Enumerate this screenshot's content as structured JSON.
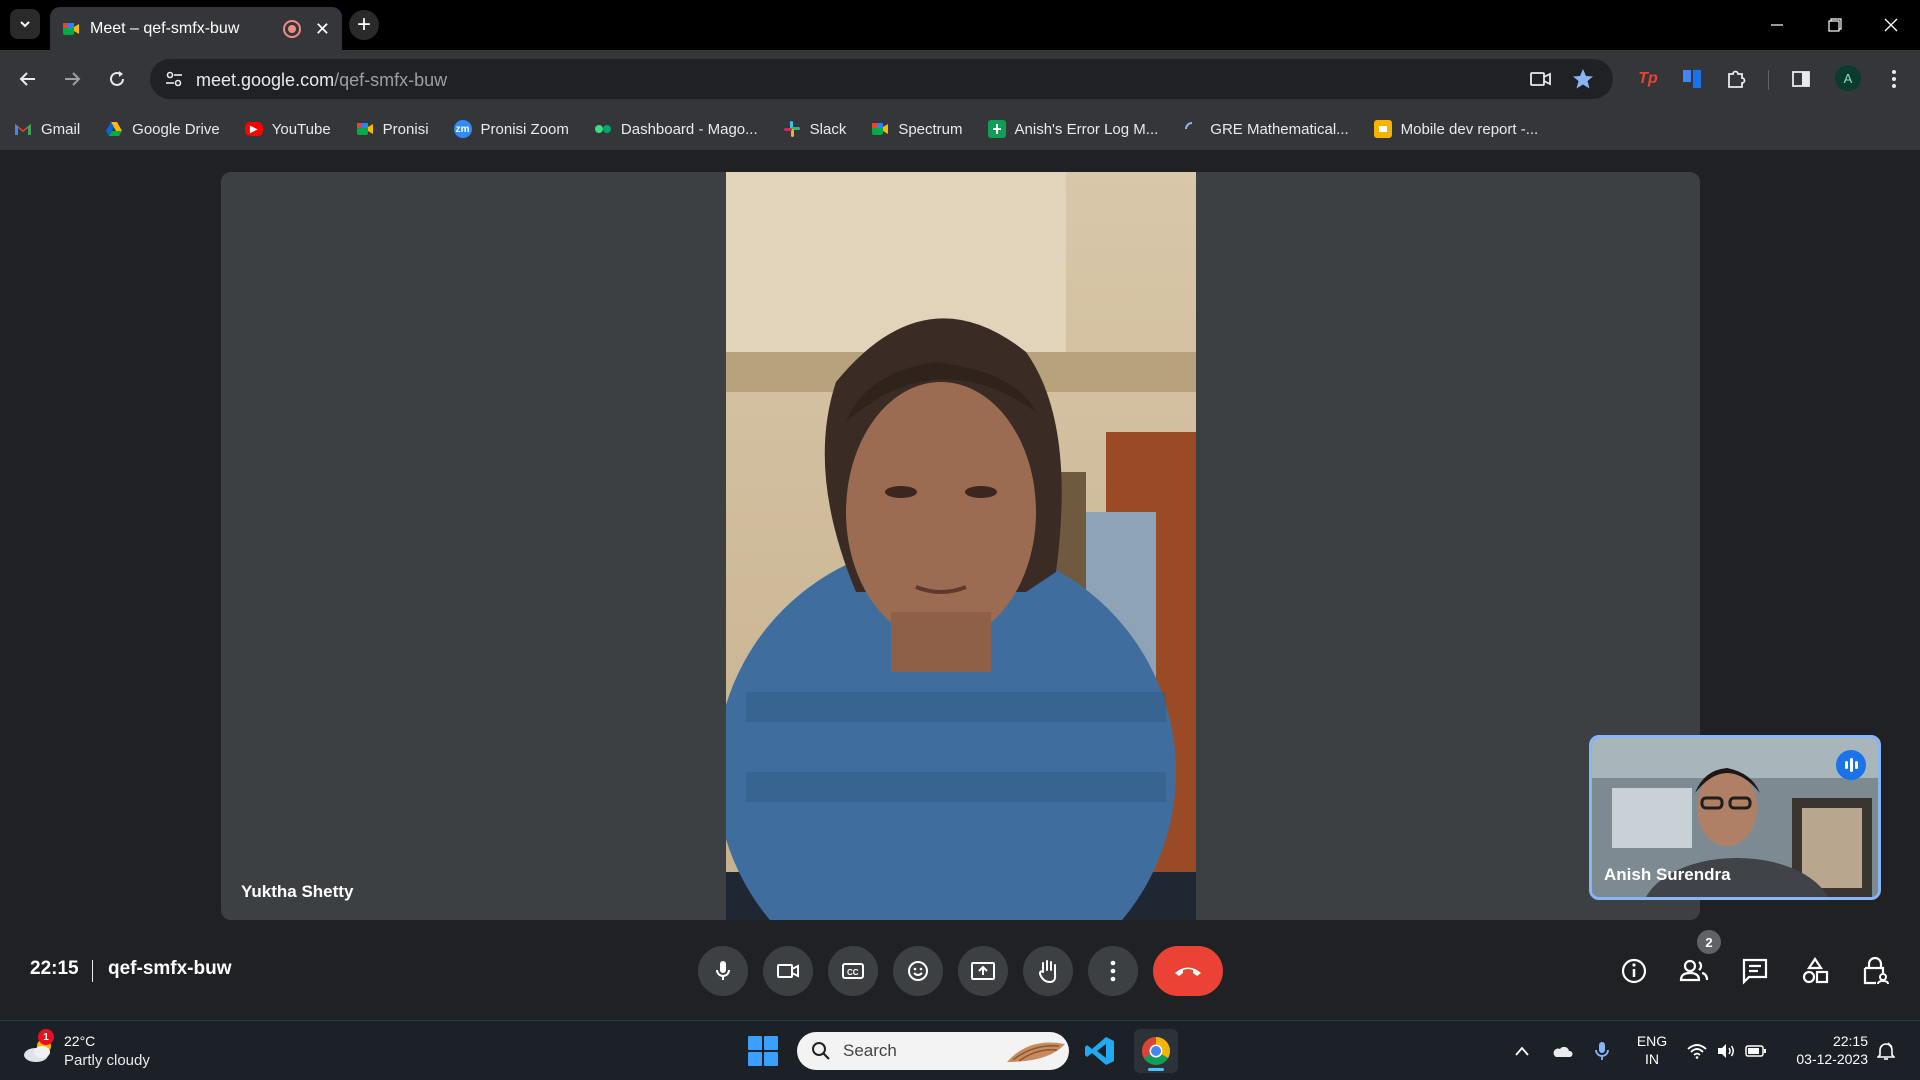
{
  "browser": {
    "tab": {
      "title": "Meet – qef-smfx-buw"
    },
    "url": {
      "host": "meet.google.com",
      "path": "/qef-smfx-buw"
    },
    "profile_initial": "A",
    "bookmarks": [
      {
        "label": "Gmail",
        "icon": "gmail-icon",
        "color": "#ea4335"
      },
      {
        "label": "Google Drive",
        "icon": "google-drive-icon",
        "color": "#1fa463"
      },
      {
        "label": "YouTube",
        "icon": "youtube-icon",
        "color": "#ff0000"
      },
      {
        "label": "Pronisi",
        "icon": "meet-icon",
        "color": "#00832d"
      },
      {
        "label": "Pronisi Zoom",
        "icon": "zoom-icon",
        "color": "#2d8cff"
      },
      {
        "label": "Dashboard - Mago...",
        "icon": "dashboard-icon",
        "color": "#3ddc84"
      },
      {
        "label": "Slack",
        "icon": "slack-icon",
        "color": "#e01e5a"
      },
      {
        "label": "Spectrum",
        "icon": "meet-icon",
        "color": "#00832d"
      },
      {
        "label": "Anish's Error Log M...",
        "icon": "sheets-icon",
        "color": "#0f9d58"
      },
      {
        "label": "GRE Mathematical...",
        "icon": "loading-icon",
        "color": "#8ab4f8"
      },
      {
        "label": "Mobile dev report -...",
        "icon": "slides-icon",
        "color": "#f4b400"
      }
    ]
  },
  "meet": {
    "main_participant": "Yuktha Shetty",
    "pip_participant": "Anish Surendra",
    "time": "22:15",
    "meeting_code": "qef-smfx-buw",
    "people_count": "2",
    "accent_color": "#8ab4f8",
    "hangup_color": "#ea4335"
  },
  "taskbar": {
    "weather": {
      "temp": "22°C",
      "desc": "Partly cloudy",
      "badge": "1"
    },
    "search_placeholder": "Search",
    "lang": {
      "line1": "ENG",
      "line2": "IN"
    },
    "clock": {
      "time": "22:15",
      "date": "03-12-2023"
    }
  }
}
